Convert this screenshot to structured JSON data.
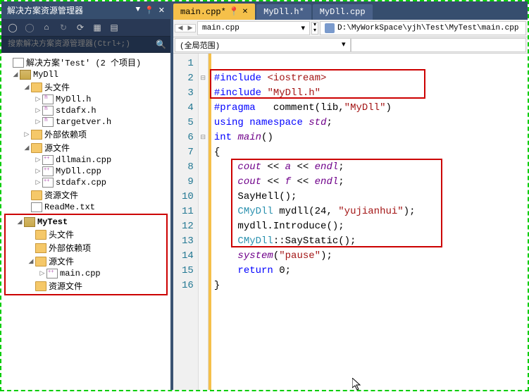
{
  "explorer": {
    "title": "解决方案资源管理器",
    "search_placeholder": "搜索解决方案资源管理器(Ctrl+;)",
    "solution": "解决方案'Test' (2 个项目)",
    "proj1": {
      "name": "MyDll",
      "folders": {
        "headers": "头文件",
        "extdeps": "外部依赖项",
        "source": "源文件",
        "resource": "资源文件"
      },
      "files": {
        "h1": "MyDll.h",
        "h2": "stdafx.h",
        "h3": "targetver.h",
        "c1": "dllmain.cpp",
        "c2": "MyDll.cpp",
        "c3": "stdafx.cpp",
        "readme": "ReadMe.txt"
      }
    },
    "proj2": {
      "name": "MyTest",
      "folders": {
        "headers": "头文件",
        "extdeps": "外部依赖项",
        "source": "源文件",
        "resource": "资源文件"
      },
      "files": {
        "c1": "main.cpp"
      }
    }
  },
  "tabs": {
    "t1": "main.cpp*",
    "t2": "MyDll.h*",
    "t3": "MyDll.cpp"
  },
  "nav": {
    "file_drop": "main.cpp",
    "path": "D:\\MyWorkSpace\\yjh\\Test\\MyTest\\main.cpp",
    "scope": "(全局范围)"
  },
  "code": {
    "l1": "",
    "l2a": "#include",
    "l2b": "<iostream>",
    "l3a": "#include",
    "l3b": "\"MyDll.h\"",
    "l4a": "#pragma",
    "l4b": "comment",
    "l4c": "(lib,",
    "l4d": "\"MyDll\"",
    "l4e": ")",
    "l5a": "using",
    "l5b": "namespace",
    "l5c": "std",
    "l5d": ";",
    "l6a": "int",
    "l6b": "main",
    "l6c": "()",
    "l7": "{",
    "l8a": "cout",
    "l8b": " << ",
    "l8c": "a",
    "l8d": " << ",
    "l8e": "endl",
    "l8f": ";",
    "l9a": "cout",
    "l9b": " << ",
    "l9c": "f",
    "l9d": " << ",
    "l9e": "endl",
    "l9f": ";",
    "l10a": "SayHell",
    "l10b": "();",
    "l11a": "CMyDll",
    "l11b": " mydll(24, ",
    "l11c": "\"yujianhui\"",
    "l11d": ");",
    "l12a": "mydll.Introduce();",
    "l13a": "CMyDll",
    "l13b": "::SayStatic();",
    "l14a": "system",
    "l14b": "(",
    "l14c": "\"pause\"",
    "l14d": ");",
    "l15a": "return",
    "l15b": " 0;",
    "l16": "}"
  },
  "line_numbers": [
    "1",
    "2",
    "3",
    "4",
    "5",
    "6",
    "7",
    "8",
    "9",
    "10",
    "11",
    "12",
    "13",
    "14",
    "15",
    "16"
  ]
}
